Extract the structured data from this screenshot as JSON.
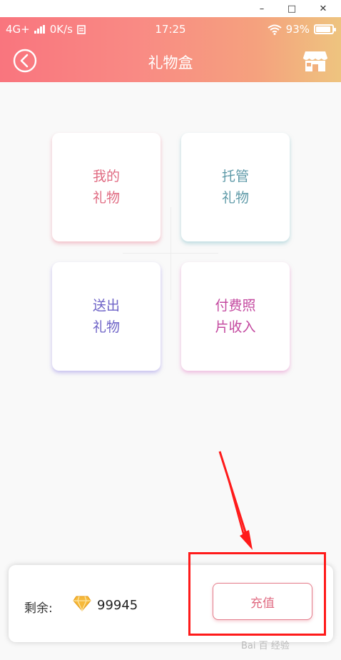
{
  "window": {
    "minimize": "–",
    "maximize": "□",
    "close": "✕"
  },
  "status": {
    "network": "4G+",
    "speed": "0K/s",
    "time": "17:25",
    "battery": "93%",
    "battery_level": 0.93
  },
  "nav": {
    "title": "礼物盒",
    "back_icon": "chevron-left-circle-icon",
    "store_icon": "store-icon"
  },
  "tiles": [
    {
      "line1": "我的",
      "line2": "礼物"
    },
    {
      "line1": "托管",
      "line2": "礼物"
    },
    {
      "line1": "送出",
      "line2": "礼物"
    },
    {
      "line1": "付费照",
      "line2": "片收入"
    }
  ],
  "balance": {
    "label": "剩余:",
    "value": "99945",
    "recharge": "充值"
  },
  "watermark": "Bai 百 经验",
  "colors": {
    "accent": "#f9757e",
    "highlight": "#ff1a1a"
  }
}
